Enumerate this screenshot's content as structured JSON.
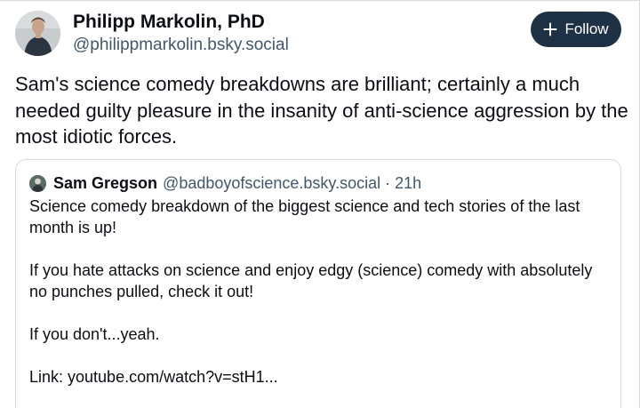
{
  "author": {
    "name": "Philipp Markolin, PhD",
    "handle": "@philippmarkolin.bsky.social",
    "avatar_icon": "person-avatar"
  },
  "follow_button": {
    "label": "Follow",
    "icon": "plus-icon"
  },
  "post": {
    "text": "Sam's science comedy breakdowns are brilliant; certainly a much needed guilty pleasure in the insanity of anti-science aggression by the most idiotic forces."
  },
  "quote": {
    "author_name": "Sam Gregson",
    "author_handle": "@badboyofscience.bsky.social",
    "separator": "·",
    "time": "21h",
    "paragraphs": [
      "Science comedy breakdown of the biggest science and tech stories of the last month is up!",
      "If you hate attacks on science and enjoy edgy (science) comedy with absolutely no punches pulled, check it out!",
      "If you don't...yeah.",
      "Link: youtube.com/watch?v=stH1..."
    ]
  },
  "colors": {
    "text": "#0b0f14",
    "muted": "#42576c",
    "button_bg": "#1f3245",
    "border": "#d4dbe2"
  }
}
